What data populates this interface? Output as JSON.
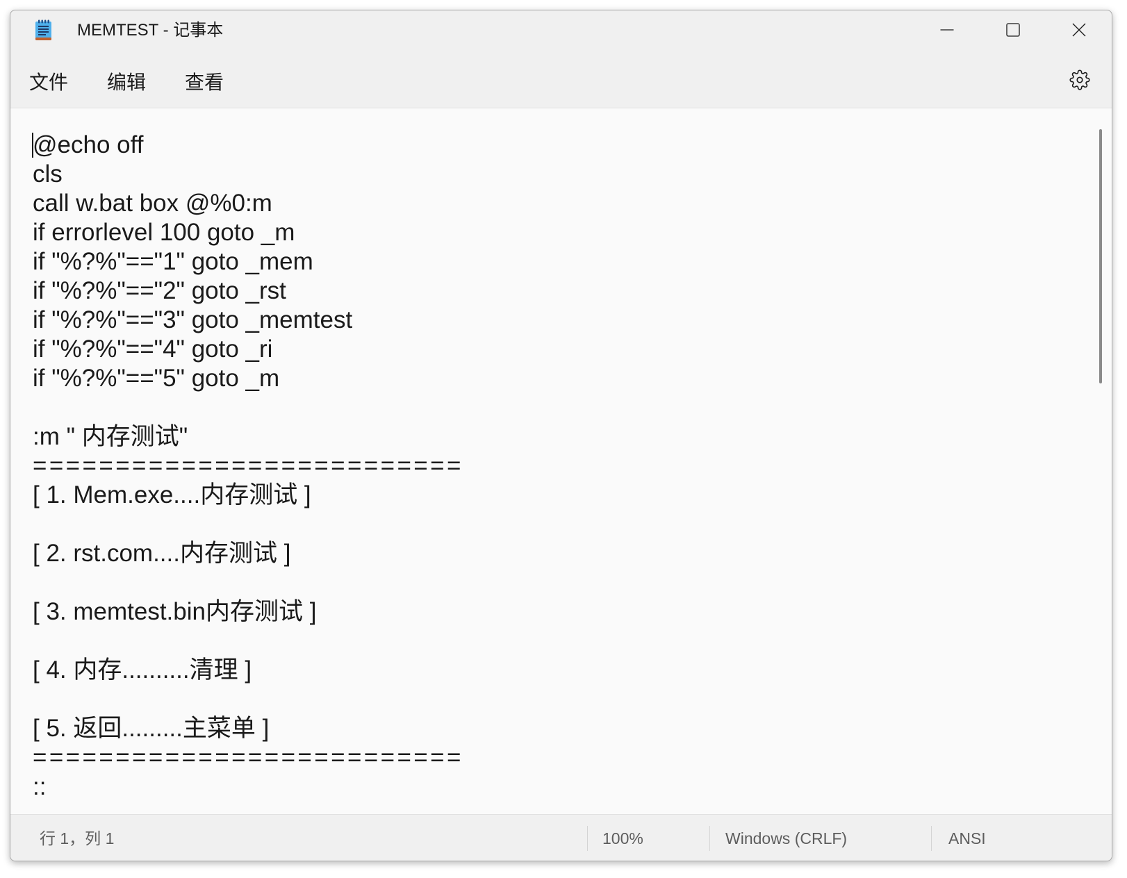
{
  "window": {
    "title": "MEMTEST - 记事本"
  },
  "menu": {
    "items": [
      {
        "label": "文件"
      },
      {
        "label": "编辑"
      },
      {
        "label": "查看"
      }
    ]
  },
  "editor": {
    "lines": [
      "@echo off",
      "cls",
      "call w.bat box @%0:m",
      "if errorlevel 100 goto _m",
      "if \"%?%\"==\"1\" goto _mem",
      "if \"%?%\"==\"2\" goto _rst",
      "if \"%?%\"==\"3\" goto _memtest",
      "if \"%?%\"==\"4\" goto _ri",
      "if \"%?%\"==\"5\" goto _m",
      "",
      ":m \" 内存测试\"",
      "==========================",
      "[ 1. Mem.exe....内存测试 ]",
      "",
      "[ 2. rst.com....内存测试 ]",
      "",
      "[ 3. memtest.bin内存测试 ]",
      "",
      "[ 4. 内存..........清理 ]",
      "",
      "[ 5. 返回.........主菜单 ]",
      "==========================",
      "::"
    ]
  },
  "status": {
    "position": "行 1，列 1",
    "zoom": "100%",
    "line_ending": "Windows (CRLF)",
    "encoding": "ANSI"
  },
  "icons": {
    "app": "notepad-icon",
    "minimize": "minimize-icon",
    "maximize": "maximize-icon",
    "close": "close-icon",
    "settings": "gear-icon"
  },
  "colors": {
    "app_icon": "#4fb0ec",
    "app_icon_base": "#c0602e",
    "app_icon_lines": "#203a66"
  }
}
